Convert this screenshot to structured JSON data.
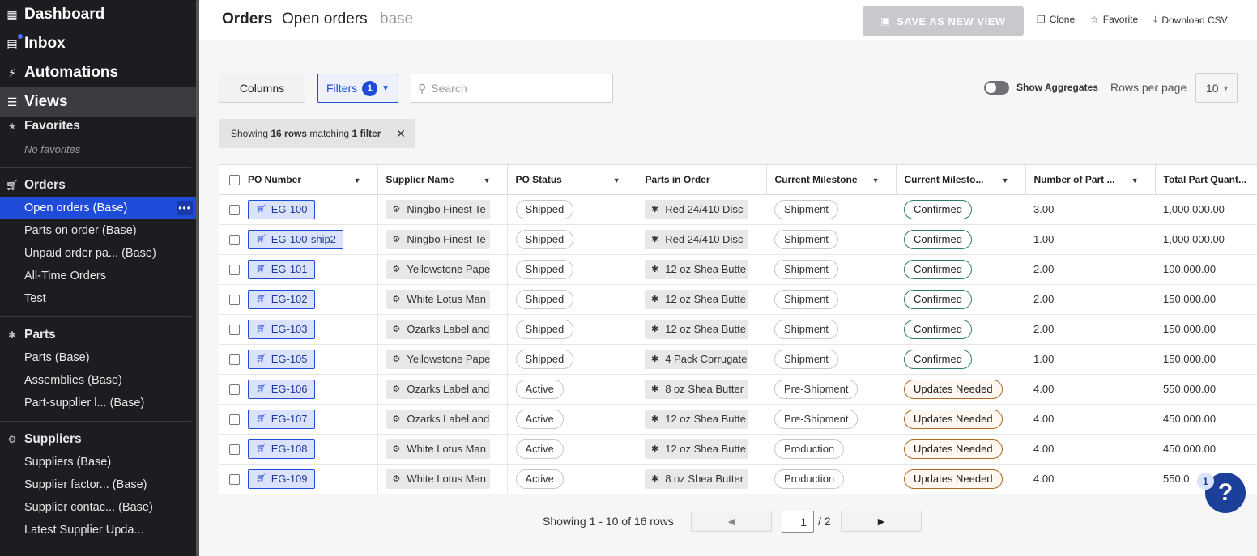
{
  "sidebar": {
    "top": [
      {
        "label": "Dashboard",
        "icon": "dashboard-icon"
      },
      {
        "label": "Inbox",
        "icon": "inbox-icon"
      },
      {
        "label": "Automations",
        "icon": "bolt-icon"
      },
      {
        "label": "Views",
        "icon": "list-icon"
      }
    ],
    "favorites": {
      "label": "Favorites",
      "empty_text": "No favorites"
    },
    "orders": {
      "label": "Orders",
      "items": [
        "Open orders (Base)",
        "Parts on order (Base)",
        "Unpaid order pa... (Base)",
        "All-Time Orders",
        "Test"
      ]
    },
    "parts": {
      "label": "Parts",
      "items": [
        "Parts (Base)",
        "Assemblies (Base)",
        "Part-supplier l... (Base)"
      ]
    },
    "suppliers": {
      "label": "Suppliers",
      "items": [
        "Suppliers (Base)",
        "Supplier factor... (Base)",
        "Supplier contac... (Base)",
        "Latest Supplier Upda..."
      ]
    },
    "more_label": "•••"
  },
  "header": {
    "section": "Orders",
    "view": "Open orders",
    "base": "base",
    "save_label": "SAVE AS NEW VIEW",
    "clone_label": "Clone",
    "favorite_label": "Favorite",
    "download_label": "Download CSV"
  },
  "toolbar": {
    "columns_label": "Columns",
    "filters_label": "Filters",
    "filters_count": "1",
    "search_placeholder": "Search",
    "aggregates_label": "Show Aggregates",
    "rows_per_page_label": "Rows per page",
    "rows_per_page_value": "10"
  },
  "filter_summary": {
    "prefix": "Showing ",
    "rows": "16 rows",
    "middle": " matching ",
    "filters": "1 filter"
  },
  "table": {
    "columns": [
      "PO Number",
      "Supplier Name",
      "PO Status",
      "Parts in Order",
      "Current Milestone",
      "Current Milesto...",
      "Number of Part ...",
      "Total Part Quant..."
    ],
    "rows": [
      {
        "po": "EG-100",
        "supplier": "Ningbo Finest Te",
        "status": "Shipped",
        "part": "Red 24/410 Disc",
        "milestone": "Shipment",
        "ms_status": "Confirmed",
        "num_parts": "3.00",
        "total_qty": "1,000,000.00"
      },
      {
        "po": "EG-100-ship2",
        "supplier": "Ningbo Finest Te",
        "status": "Shipped",
        "part": "Red 24/410 Disc",
        "milestone": "Shipment",
        "ms_status": "Confirmed",
        "num_parts": "1.00",
        "total_qty": "1,000,000.00"
      },
      {
        "po": "EG-101",
        "supplier": "Yellowstone Pape",
        "status": "Shipped",
        "part": "12 oz Shea Butte",
        "milestone": "Shipment",
        "ms_status": "Confirmed",
        "num_parts": "2.00",
        "total_qty": "100,000.00"
      },
      {
        "po": "EG-102",
        "supplier": "White Lotus Man",
        "status": "Shipped",
        "part": "12 oz Shea Butte",
        "milestone": "Shipment",
        "ms_status": "Confirmed",
        "num_parts": "2.00",
        "total_qty": "150,000.00"
      },
      {
        "po": "EG-103",
        "supplier": "Ozarks Label and",
        "status": "Shipped",
        "part": "12 oz Shea Butte",
        "milestone": "Shipment",
        "ms_status": "Confirmed",
        "num_parts": "2.00",
        "total_qty": "150,000.00"
      },
      {
        "po": "EG-105",
        "supplier": "Yellowstone Pape",
        "status": "Shipped",
        "part": "4 Pack Corrugate",
        "milestone": "Shipment",
        "ms_status": "Confirmed",
        "num_parts": "1.00",
        "total_qty": "150,000.00"
      },
      {
        "po": "EG-106",
        "supplier": "Ozarks Label and",
        "status": "Active",
        "part": "8 oz Shea Butter",
        "milestone": "Pre-Shipment",
        "ms_status": "Updates Needed",
        "num_parts": "4.00",
        "total_qty": "550,000.00"
      },
      {
        "po": "EG-107",
        "supplier": "Ozarks Label and",
        "status": "Active",
        "part": "12 oz Shea Butte",
        "milestone": "Pre-Shipment",
        "ms_status": "Updates Needed",
        "num_parts": "4.00",
        "total_qty": "450,000.00"
      },
      {
        "po": "EG-108",
        "supplier": "White Lotus Man",
        "status": "Active",
        "part": "12 oz Shea Butte",
        "milestone": "Production",
        "ms_status": "Updates Needed",
        "num_parts": "4.00",
        "total_qty": "450,000.00"
      },
      {
        "po": "EG-109",
        "supplier": "White Lotus Man",
        "status": "Active",
        "part": "8 oz Shea Butter",
        "milestone": "Production",
        "ms_status": "Updates Needed",
        "num_parts": "4.00",
        "total_qty": "550,0"
      }
    ]
  },
  "pagination": {
    "summary": "Showing 1 - 10 of 16 rows",
    "current_page": "1",
    "total_pages": "/ 2"
  },
  "help": {
    "label": "?",
    "badge": "1"
  },
  "colors": {
    "accent": "#1f4bd9",
    "sidebar_bg": "#1b1d20",
    "confirmed": "#2e7d6a",
    "updates_needed": "#b06a20"
  }
}
